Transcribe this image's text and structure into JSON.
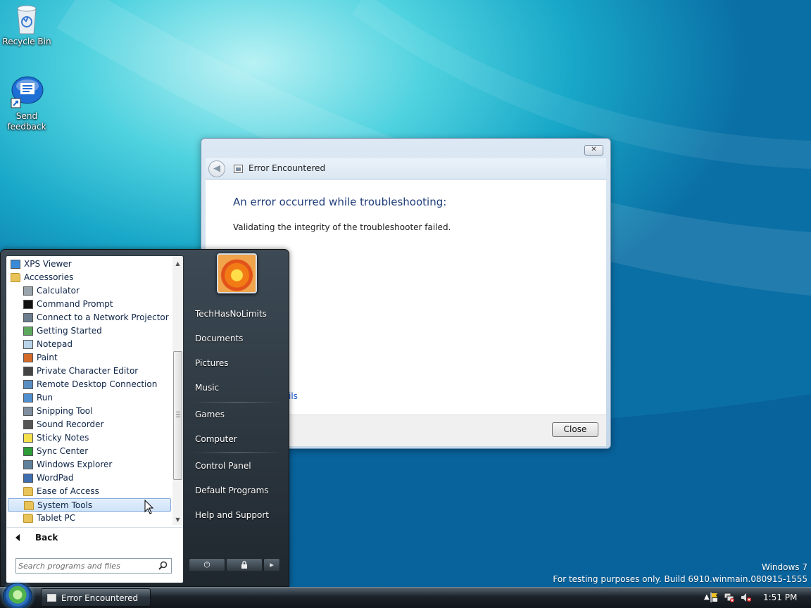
{
  "desktop": {
    "icons": [
      {
        "label": "Recycle Bin",
        "icon": "recycle-bin-icon"
      },
      {
        "label": "Send feedback",
        "icon": "send-feedback-icon"
      }
    ],
    "watermark": {
      "line1": "Windows 7",
      "line2": "For testing purposes only. Build 6910.winmain.080915-1555"
    }
  },
  "dialog": {
    "title": "Error Encountered",
    "heading": "An error occurred while troubleshooting:",
    "message": "Validating the integrity of the troubleshooter failed.",
    "details_link_fragment": "ils",
    "close_button": "Close"
  },
  "start_menu": {
    "programs": [
      {
        "label": "XPS Viewer",
        "icon": "xps-viewer-icon",
        "indent": 0
      },
      {
        "label": "Accessories",
        "icon": "folder-icon",
        "indent": 0
      },
      {
        "label": "Calculator",
        "icon": "calculator-icon",
        "indent": 1
      },
      {
        "label": "Command Prompt",
        "icon": "command-prompt-icon",
        "indent": 1
      },
      {
        "label": "Connect to a Network Projector",
        "icon": "projector-icon",
        "indent": 1
      },
      {
        "label": "Getting Started",
        "icon": "getting-started-icon",
        "indent": 1
      },
      {
        "label": "Notepad",
        "icon": "notepad-icon",
        "indent": 1
      },
      {
        "label": "Paint",
        "icon": "paint-icon",
        "indent": 1
      },
      {
        "label": "Private Character Editor",
        "icon": "character-editor-icon",
        "indent": 1
      },
      {
        "label": "Remote Desktop Connection",
        "icon": "remote-desktop-icon",
        "indent": 1
      },
      {
        "label": "Run",
        "icon": "run-icon",
        "indent": 1
      },
      {
        "label": "Snipping Tool",
        "icon": "snipping-tool-icon",
        "indent": 1
      },
      {
        "label": "Sound Recorder",
        "icon": "microphone-icon",
        "indent": 1
      },
      {
        "label": "Sticky Notes",
        "icon": "sticky-notes-icon",
        "indent": 1
      },
      {
        "label": "Sync Center",
        "icon": "sync-center-icon",
        "indent": 1
      },
      {
        "label": "Windows Explorer",
        "icon": "windows-explorer-icon",
        "indent": 1
      },
      {
        "label": "WordPad",
        "icon": "wordpad-icon",
        "indent": 1
      },
      {
        "label": "Ease of Access",
        "icon": "folder-icon",
        "indent": 1
      },
      {
        "label": "System Tools",
        "icon": "folder-icon",
        "indent": 1,
        "selected": true
      },
      {
        "label": "Tablet PC",
        "icon": "folder-icon",
        "indent": 1
      }
    ],
    "back_label": "Back",
    "search_placeholder": "Search programs and files",
    "right_links": [
      {
        "label": "TechHasNoLimits",
        "group": 1
      },
      {
        "label": "Documents",
        "group": 1
      },
      {
        "label": "Pictures",
        "group": 1
      },
      {
        "label": "Music",
        "group": 1
      },
      {
        "label": "Games",
        "group": 2
      },
      {
        "label": "Computer",
        "group": 2
      },
      {
        "label": "Control Panel",
        "group": 3
      },
      {
        "label": "Default Programs",
        "group": 3
      },
      {
        "label": "Help and Support",
        "group": 3
      }
    ]
  },
  "taskbar": {
    "task_button": "Error Encountered",
    "clock": "1:51 PM",
    "tray_icons": [
      "chevron-up-icon",
      "action-center-flag-icon",
      "network-icon",
      "volume-muted-icon"
    ]
  },
  "colors": {
    "heading_blue": "#1e3c78",
    "link_blue": "#1c5bd0",
    "selection_border": "#84acdd"
  }
}
